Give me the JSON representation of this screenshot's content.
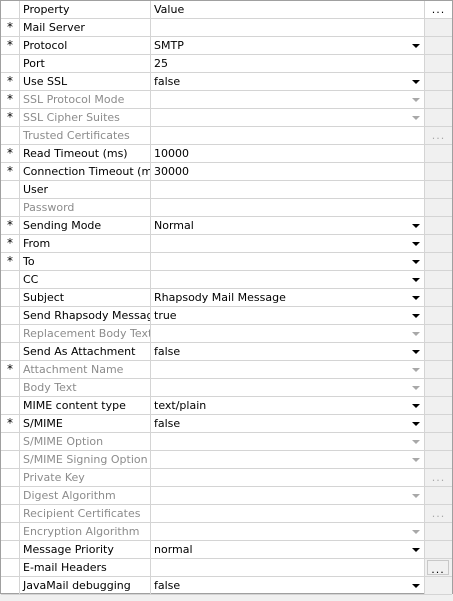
{
  "header": {
    "property_label": "Property",
    "value_label": "Value",
    "edit_all_label": "..."
  },
  "required_marker": "*",
  "rows": [
    {
      "name": "Mail Server",
      "value": "",
      "required": true,
      "enabled": true,
      "control": "none"
    },
    {
      "name": "Protocol",
      "value": "SMTP",
      "required": true,
      "enabled": true,
      "control": "dropdown"
    },
    {
      "name": "Port",
      "value": "25",
      "required": false,
      "enabled": true,
      "control": "none"
    },
    {
      "name": "Use SSL",
      "value": "false",
      "required": true,
      "enabled": true,
      "control": "dropdown"
    },
    {
      "name": "SSL Protocol Mode",
      "value": "",
      "required": true,
      "enabled": false,
      "control": "dropdown"
    },
    {
      "name": "SSL Cipher Suites",
      "value": "",
      "required": true,
      "enabled": false,
      "control": "dropdown"
    },
    {
      "name": "Trusted Certificates",
      "value": "",
      "required": false,
      "enabled": false,
      "control": "ellipsis"
    },
    {
      "name": "Read Timeout (ms)",
      "value": "10000",
      "required": true,
      "enabled": true,
      "control": "none"
    },
    {
      "name": "Connection Timeout (ms)",
      "value": "30000",
      "required": true,
      "enabled": true,
      "control": "none"
    },
    {
      "name": "User",
      "value": "",
      "required": false,
      "enabled": true,
      "control": "none"
    },
    {
      "name": "Password",
      "value": "",
      "required": false,
      "enabled": false,
      "control": "none"
    },
    {
      "name": "Sending Mode",
      "value": "Normal",
      "required": true,
      "enabled": true,
      "control": "dropdown"
    },
    {
      "name": "From",
      "value": "",
      "required": true,
      "enabled": true,
      "control": "dropdown"
    },
    {
      "name": "To",
      "value": "",
      "required": true,
      "enabled": true,
      "control": "dropdown"
    },
    {
      "name": "CC",
      "value": "",
      "required": false,
      "enabled": true,
      "control": "dropdown"
    },
    {
      "name": "Subject",
      "value": "Rhapsody Mail Message",
      "required": false,
      "enabled": true,
      "control": "dropdown"
    },
    {
      "name": "Send Rhapsody Message",
      "value": "true",
      "required": false,
      "enabled": true,
      "control": "dropdown"
    },
    {
      "name": "Replacement Body Text",
      "value": "",
      "required": false,
      "enabled": false,
      "control": "dropdown"
    },
    {
      "name": "Send As Attachment",
      "value": "false",
      "required": false,
      "enabled": true,
      "control": "dropdown"
    },
    {
      "name": "Attachment Name",
      "value": "",
      "required": true,
      "enabled": false,
      "control": "dropdown"
    },
    {
      "name": "Body Text",
      "value": "",
      "required": false,
      "enabled": false,
      "control": "dropdown"
    },
    {
      "name": "MIME content type",
      "value": "text/plain",
      "required": false,
      "enabled": true,
      "control": "dropdown"
    },
    {
      "name": "S/MIME",
      "value": "false",
      "required": true,
      "enabled": true,
      "control": "dropdown"
    },
    {
      "name": "S/MIME Option",
      "value": "",
      "required": false,
      "enabled": false,
      "control": "dropdown"
    },
    {
      "name": "S/MIME Signing Option",
      "value": "",
      "required": false,
      "enabled": false,
      "control": "dropdown"
    },
    {
      "name": "Private Key",
      "value": "",
      "required": false,
      "enabled": false,
      "control": "ellipsis"
    },
    {
      "name": "Digest Algorithm",
      "value": "",
      "required": false,
      "enabled": false,
      "control": "dropdown"
    },
    {
      "name": "Recipient Certificates",
      "value": "",
      "required": false,
      "enabled": false,
      "control": "ellipsis"
    },
    {
      "name": "Encryption Algorithm",
      "value": "",
      "required": false,
      "enabled": false,
      "control": "dropdown"
    },
    {
      "name": "Message Priority",
      "value": "normal",
      "required": false,
      "enabled": true,
      "control": "dropdown"
    },
    {
      "name": "E-mail Headers",
      "value": "",
      "required": false,
      "enabled": true,
      "control": "button"
    },
    {
      "name": "JavaMail debugging",
      "value": "false",
      "required": false,
      "enabled": true,
      "control": "dropdown"
    }
  ],
  "colors": {
    "disabled_text": "#8c8c8c",
    "grid_line": "#d4d4d4",
    "background": "#f0f0f0"
  },
  "icons": {
    "dropdown": "chevron-down-icon",
    "ellipsis": "ellipsis-icon"
  }
}
